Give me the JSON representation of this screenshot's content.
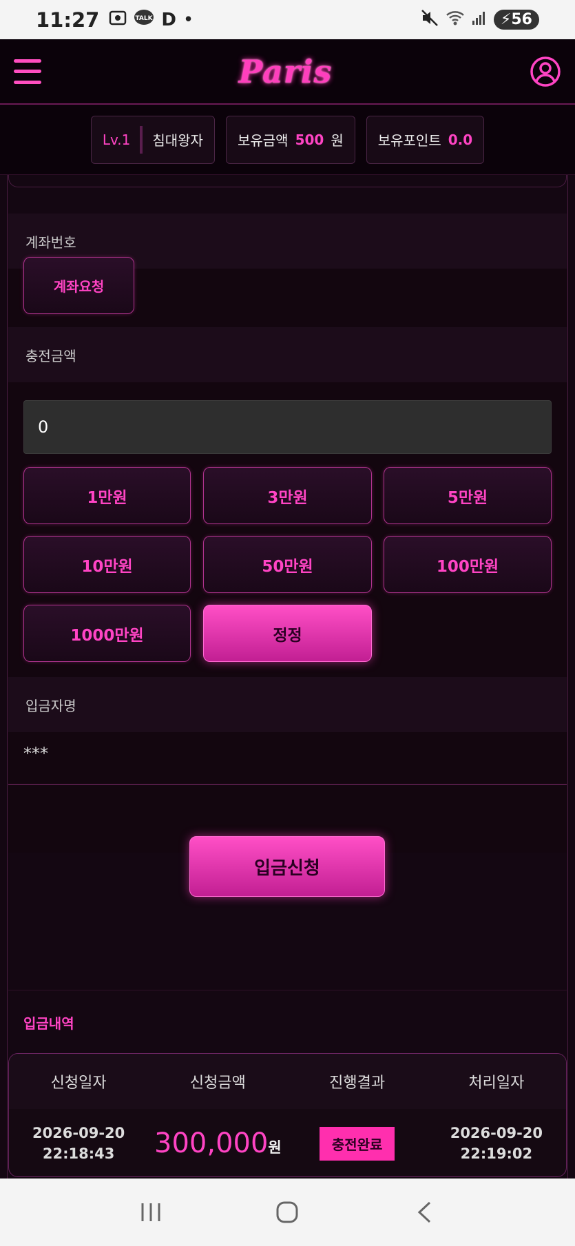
{
  "status_bar": {
    "time": "11:27",
    "notification_letter": "D",
    "battery": "56"
  },
  "header": {
    "logo_text": "Paris",
    "brand_color": "#ff3fbd"
  },
  "info_bar": {
    "level": "Lv.1",
    "username": "침대왕자",
    "balance_label": "보유금액",
    "balance_value": "500",
    "balance_unit": "원",
    "points_label": "보유포인트",
    "points_value": "0.0"
  },
  "form": {
    "account_label": "계좌번호",
    "account_request_button": "계좌요청",
    "charge_label": "충전금액",
    "charge_value": "0",
    "amount_buttons": [
      "1만원",
      "3만원",
      "5만원",
      "10만원",
      "50만원",
      "100만원",
      "1000만원"
    ],
    "reset_button": "정정",
    "depositor_label": "입금자명",
    "depositor_value": "***",
    "submit_button": "입금신청"
  },
  "history": {
    "title": "입금내역",
    "columns": [
      "신청일자",
      "신청금액",
      "진행결과",
      "처리일자"
    ],
    "rows": [
      {
        "request_date": "2026-09-20",
        "request_time": "22:18:43",
        "amount": "300,000",
        "unit": "원",
        "status": "충전완료",
        "processed_date": "2026-09-20",
        "processed_time": "22:19:02"
      }
    ]
  }
}
